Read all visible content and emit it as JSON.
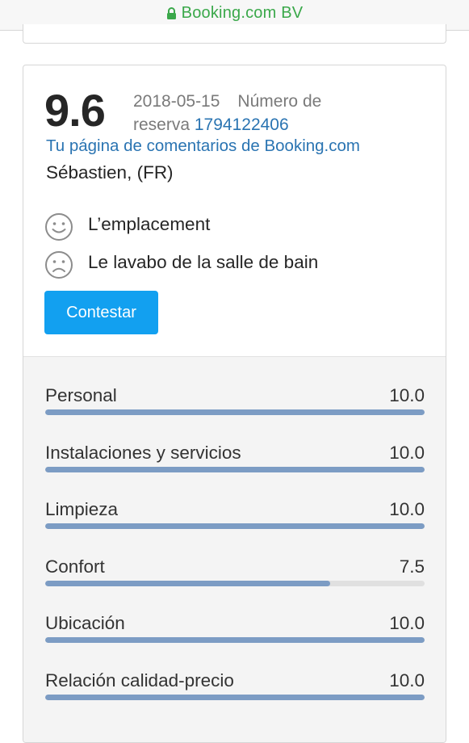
{
  "browser": {
    "url_label": "Booking.com BV",
    "lock_icon": "lock-icon",
    "url_color": "#3aa84a"
  },
  "review": {
    "score": "9.6",
    "date": "2018-05-15",
    "reservation_label": "Número de reserva",
    "reservation_number": "1794122406",
    "reviews_page_link": "Tu página de comentarios de Booking.com",
    "author": "Sébastien, (FR)",
    "positive": {
      "icon": "smiley-face-icon",
      "text": "L’emplacement"
    },
    "negative": {
      "icon": "sad-face-icon",
      "text": "Le lavabo de la salle de bain"
    },
    "reply_button_label": "Contestar"
  },
  "category_scores": [
    {
      "label": "Personal",
      "value": "10.0",
      "fraction": 1.0
    },
    {
      "label": "Instalaciones y servicios",
      "value": "10.0",
      "fraction": 1.0
    },
    {
      "label": "Limpieza",
      "value": "10.0",
      "fraction": 1.0
    },
    {
      "label": "Confort",
      "value": "7.5",
      "fraction": 0.75
    },
    {
      "label": "Ubicación",
      "value": "10.0",
      "fraction": 1.0
    },
    {
      "label": "Relación calidad-precio",
      "value": "10.0",
      "fraction": 1.0
    }
  ],
  "colors": {
    "link": "#2a74b2",
    "button": "#12a0f0",
    "bar_fill": "#7c9cc4",
    "bar_track": "#e0e0e0"
  }
}
